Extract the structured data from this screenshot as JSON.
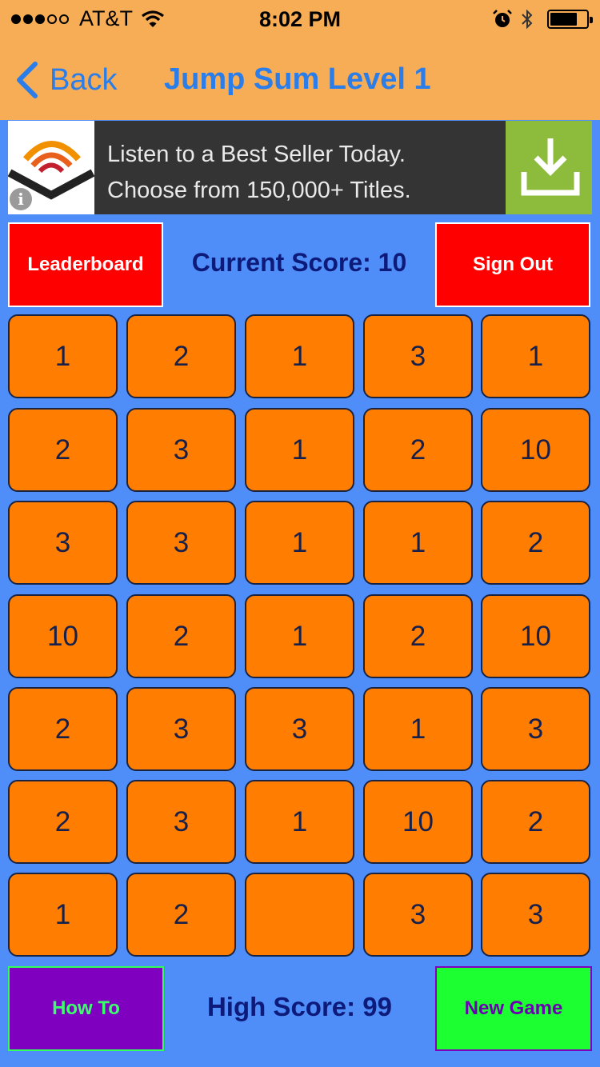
{
  "status_bar": {
    "signal_filled": 3,
    "signal_total": 5,
    "carrier": "AT&T",
    "time": "8:02 PM",
    "battery_level": 0.75
  },
  "nav": {
    "back_label": "Back",
    "title": "Jump Sum Level 1"
  },
  "ad": {
    "line1": "Listen to a Best Seller Today.",
    "line2": "Choose from 150,000+ Titles.",
    "info_glyph": "i",
    "logo_icon": "audible-logo-icon",
    "download_icon": "download-icon"
  },
  "controls": {
    "leaderboard_label": "Leaderboard",
    "current_score": "Current Score: 10",
    "sign_out_label": "Sign Out",
    "how_to_label": "How To",
    "high_score": "High Score: 99",
    "new_game_label": "New Game"
  },
  "board": {
    "rows": [
      [
        "1",
        "2",
        "1",
        "3",
        "1"
      ],
      [
        "2",
        "3",
        "1",
        "2",
        "10"
      ],
      [
        "3",
        "3",
        "1",
        "1",
        "2"
      ],
      [
        "10",
        "2",
        "1",
        "2",
        "10"
      ],
      [
        "2",
        "3",
        "3",
        "1",
        "3"
      ],
      [
        "2",
        "3",
        "1",
        "10",
        "2"
      ],
      [
        "1",
        "2",
        "",
        "3",
        "3"
      ]
    ]
  },
  "colors": {
    "background": "#4f8ef8",
    "top_bar": "#f6ad55",
    "accent": "#2b7de9",
    "tile": "#ff7d00",
    "red_button": "#ff0000",
    "how_to_button": "#8000c0",
    "new_game_button": "#1cff31",
    "score_text": "#0d1a7a"
  }
}
